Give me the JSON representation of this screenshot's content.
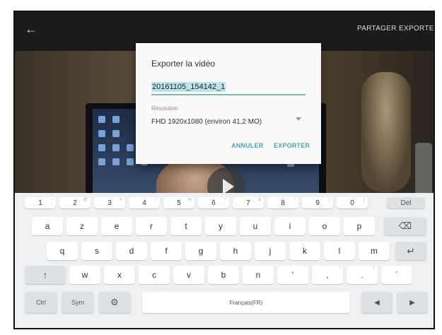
{
  "topbar": {
    "back_icon": "arrow-left-icon",
    "share_label": "PARTAGER",
    "export_label": "EXPORTER"
  },
  "video": {
    "play_icon": "play-icon"
  },
  "dialog": {
    "title": "Exporter la vidéo",
    "filename": "20161105_154142_1",
    "resolution_label": "Résolution",
    "resolution_value": "FHD 1920x1080 (environ 41,2 MO)",
    "cancel_label": "ANNULER",
    "export_label": "EXPORTER",
    "accent_color": "#4aa3b3"
  },
  "keyboard": {
    "number_row": [
      {
        "main": "1",
        "sub": "~"
      },
      {
        "main": "2",
        "sub": "@"
      },
      {
        "main": "3",
        "sub": "#"
      },
      {
        "main": "4",
        "sub": "/"
      },
      {
        "main": "5",
        "sub": "%"
      },
      {
        "main": "6",
        "sub": "^"
      },
      {
        "main": "7",
        "sub": "&"
      },
      {
        "main": "8",
        "sub": "*"
      },
      {
        "main": "9",
        "sub": "("
      },
      {
        "main": "0",
        "sub": ")"
      }
    ],
    "del_label": "Del",
    "row1": [
      "a",
      "z",
      "e",
      "r",
      "t",
      "y",
      "u",
      "i",
      "o",
      "p"
    ],
    "backspace_icon": "backspace-icon",
    "row2": [
      "q",
      "s",
      "d",
      "f",
      "g",
      "h",
      "j",
      "k",
      "l",
      "m"
    ],
    "enter_icon": "enter-icon",
    "shift_icon": "shift-arrow-icon",
    "row3": [
      "w",
      "x",
      "c",
      "v",
      "b",
      "n"
    ],
    "row3_punct": [
      {
        "main": "'",
        "sub": "\""
      },
      {
        "main": ",",
        "sub": "!"
      },
      {
        "main": ".",
        "sub": "?"
      },
      {
        "main": "´",
        "sub": ""
      }
    ],
    "ctrl_label": "Ctrl",
    "sym_label": "Sym",
    "settings_icon": "gear-icon",
    "space_label": "Français(FR)",
    "left_icon": "arrow-left-key-icon",
    "right_icon": "arrow-right-key-icon"
  }
}
